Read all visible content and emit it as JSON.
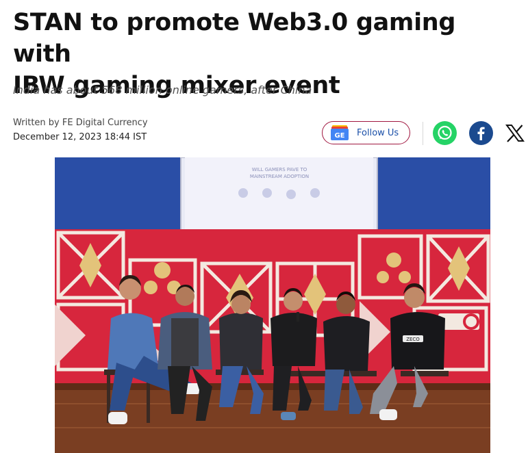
{
  "article": {
    "headline_line1": "STAN to promote Web3.0 gaming with",
    "headline_line2": "IBW gaming mixer event",
    "subheadline": "India has about 568 million online gamers, after China",
    "byline": "Written by FE Digital Currency",
    "date": "December 12, 2023 18:44 IST"
  },
  "actions": {
    "follow_label": "Follow Us",
    "google_news_badge": "GE"
  },
  "share": {
    "whatsapp_icon": "whatsapp-icon",
    "facebook_icon": "facebook-icon",
    "x_icon": "x-icon"
  },
  "photo": {
    "screen_text_line1": "WILL GAMERS PAVE TO",
    "screen_text_line2": "MAINSTREAM ADOPTION",
    "shirt_text": "ZECO"
  },
  "colors": {
    "follow_border": "#a0163f",
    "follow_text": "#1a4fa8",
    "whatsapp": "#25d366",
    "facebook": "#1b4a8f"
  }
}
